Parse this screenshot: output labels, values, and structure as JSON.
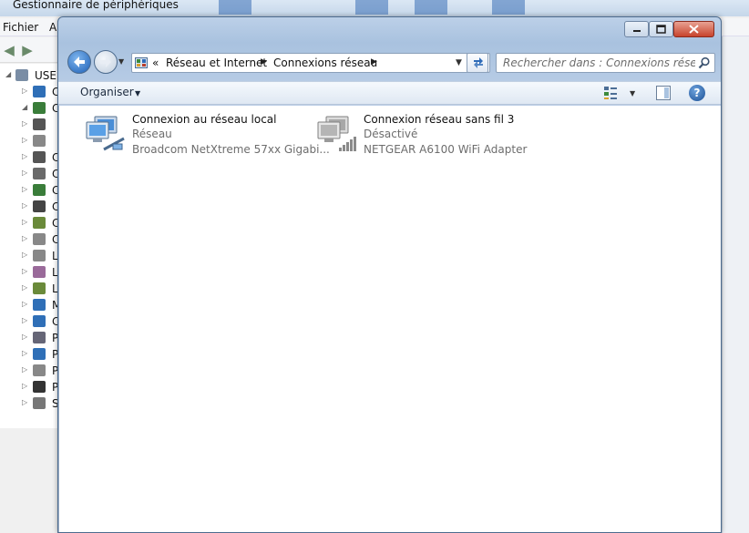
{
  "background_window": {
    "title": "Gestionnaire de périphériques",
    "menu": {
      "file": "Fichier",
      "action": "A"
    },
    "tree_root": "USER",
    "tree_letters": [
      "C",
      "C",
      "",
      "",
      "C",
      "C",
      "C",
      "C",
      "C",
      "C",
      "L",
      "L",
      "L",
      "M",
      "C",
      "P",
      "P",
      "P",
      "P",
      "S"
    ]
  },
  "window": {
    "addressbar": {
      "overflow": "«",
      "crumbs": [
        "Réseau et Internet",
        "Connexions réseau"
      ]
    },
    "search": {
      "placeholder": "Rechercher dans : Connexions réseau"
    },
    "commandbar": {
      "organise_label": "Organiser"
    },
    "help_label": "?",
    "connections": [
      {
        "name": "Connexion au réseau local",
        "status": "Réseau",
        "adapter": "Broadcom NetXtreme 57xx Gigabi...",
        "icon": "wired-network-icon"
      },
      {
        "name": "Connexion réseau sans fil 3",
        "status": "Désactivé",
        "adapter": "NETGEAR A6100 WiFi Adapter",
        "icon": "wireless-network-disabled-icon"
      }
    ]
  },
  "colors": {
    "accent": "#1d5fb6",
    "frame": "#a9c2df",
    "close": "#c8432c",
    "secondary_text": "#6d6d6d"
  }
}
